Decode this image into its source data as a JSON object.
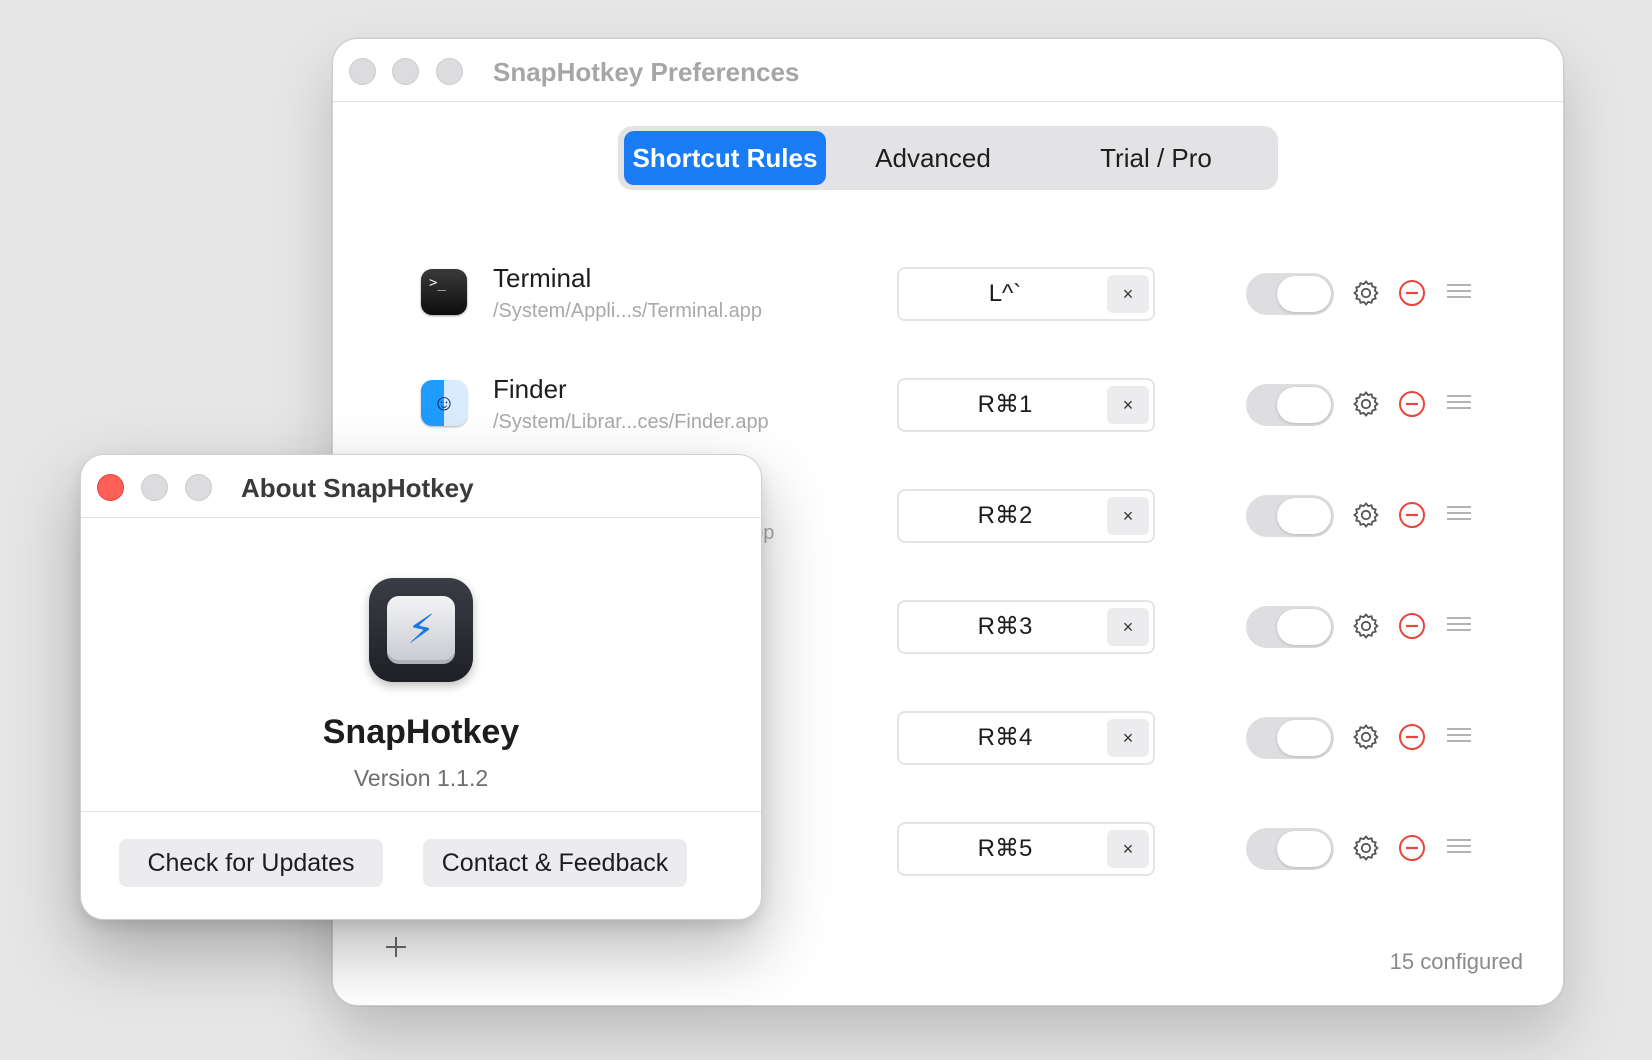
{
  "prefs": {
    "title": "SnapHotkey Preferences",
    "tabs": [
      {
        "label": "Shortcut Rules",
        "active": true
      },
      {
        "label": "Advanced",
        "active": false
      },
      {
        "label": "Trial / Pro",
        "active": false
      }
    ],
    "rules": [
      {
        "name": "Terminal",
        "path": "/System/Appli...s/Terminal.app",
        "shortcut": "L^`",
        "clear": "×",
        "icon": "terminal-icon",
        "enabled": true
      },
      {
        "name": "Finder",
        "path": "/System/Librar...ces/Finder.app",
        "shortcut": "R⌘1",
        "clear": "×",
        "icon": "finder-icon",
        "enabled": true
      },
      {
        "name": "",
        "path": "app",
        "shortcut": "R⌘2",
        "clear": "×",
        "icon": "",
        "enabled": true
      },
      {
        "name": "",
        "path": "",
        "shortcut": "R⌘3",
        "clear": "×",
        "icon": "",
        "enabled": true
      },
      {
        "name": "",
        "path": "",
        "shortcut": "R⌘4",
        "clear": "×",
        "icon": "",
        "enabled": true
      },
      {
        "name": "",
        "path": "",
        "shortcut": "R⌘5",
        "clear": "×",
        "icon": "",
        "enabled": true
      }
    ],
    "add_symbol": "+",
    "count_text": "15 configured"
  },
  "about": {
    "title": "About SnapHotkey",
    "app_name": "SnapHotkey",
    "version": "Version 1.1.2",
    "check_updates": "Check for Updates",
    "contact": "Contact & Feedback",
    "badge_glyph": "⚡"
  },
  "colors": {
    "accent": "#1a7cf5",
    "close_red": "#ff5f57",
    "remove_red": "#e8453c"
  }
}
